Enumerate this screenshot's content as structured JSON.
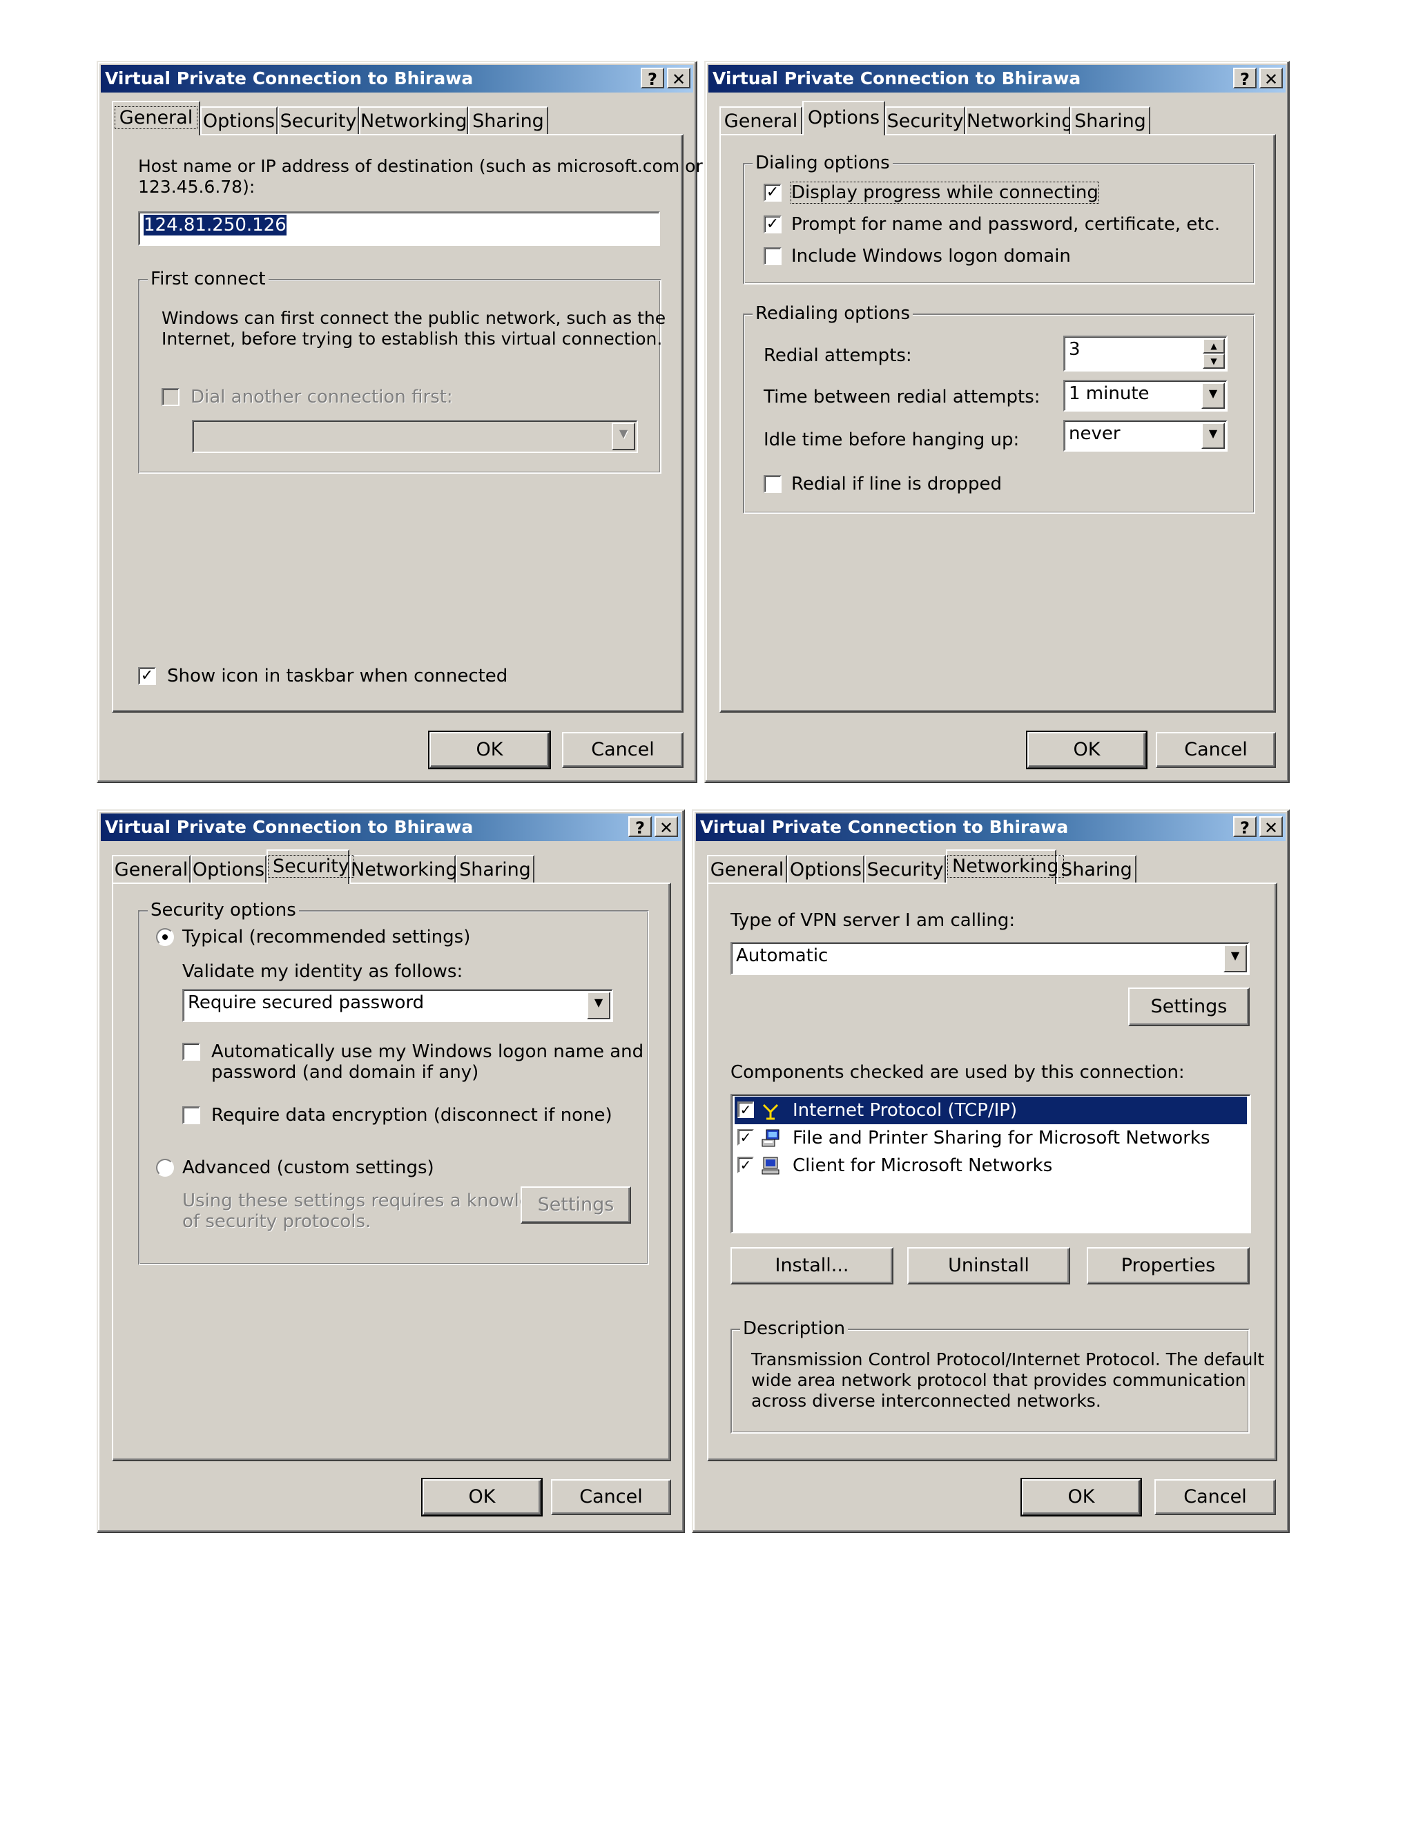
{
  "title": "Virtual Private Connection to Bhirawa",
  "title_buttons": {
    "help": "?",
    "close": "✕"
  },
  "tabs": [
    "General",
    "Options",
    "Security",
    "Networking",
    "Sharing"
  ],
  "buttons": {
    "ok": "OK",
    "cancel": "Cancel"
  },
  "general": {
    "host_label_1": "Host name or IP address of destination (such as microsoft.com or",
    "host_label_2": "123.45.6.78):",
    "host_value": "124.81.250.126",
    "first_connect_legend": "First connect",
    "first_connect_text_1": "Windows can first connect the public network, such as the",
    "first_connect_text_2": "Internet, before trying to establish this virtual connection.",
    "dial_another_label": "Dial another connection first:",
    "dial_another_checked": false,
    "show_icon_label": "Show icon in taskbar when connected",
    "show_icon_checked": true
  },
  "options": {
    "dialing_legend": "Dialing options",
    "display_progress_label": "Display progress while connecting",
    "display_progress_checked": true,
    "prompt_label": "Prompt for name and password, certificate, etc.",
    "prompt_checked": true,
    "include_domain_label": "Include Windows logon domain",
    "include_domain_checked": false,
    "redialing_legend": "Redialing options",
    "redial_attempts_label": "Redial attempts:",
    "redial_attempts_value": "3",
    "time_between_label": "Time between redial attempts:",
    "time_between_value": "1 minute",
    "idle_time_label": "Idle time before hanging up:",
    "idle_time_value": "never",
    "redial_dropped_label": "Redial if line is dropped",
    "redial_dropped_checked": false
  },
  "security": {
    "security_legend": "Security options",
    "typical_label": "Typical (recommended settings)",
    "typical_selected": true,
    "validate_label": "Validate my identity as follows:",
    "validate_value": "Require secured password",
    "auto_logon_label_1": "Automatically use my Windows logon name and",
    "auto_logon_label_2": "password (and domain if any)",
    "auto_logon_checked": false,
    "require_encryption_label": "Require data encryption (disconnect if none)",
    "require_encryption_checked": false,
    "advanced_label": "Advanced (custom settings)",
    "advanced_selected": false,
    "advanced_note_1": "Using these settings requires a knowledge",
    "advanced_note_2": "of security protocols.",
    "settings_button": "Settings"
  },
  "networking": {
    "vpn_type_label": "Type of VPN server I am calling:",
    "vpn_type_value": "Automatic",
    "settings_button": "Settings",
    "components_label": "Components checked are used by this connection:",
    "components": [
      {
        "label": "Internet Protocol (TCP/IP)",
        "checked": true,
        "icon": "network-protocol-icon",
        "selected": true
      },
      {
        "label": "File and Printer Sharing for Microsoft Networks",
        "checked": true,
        "icon": "file-printer-sharing-icon",
        "selected": false
      },
      {
        "label": "Client for Microsoft Networks",
        "checked": true,
        "icon": "network-client-icon",
        "selected": false
      }
    ],
    "install_button": "Install...",
    "uninstall_button": "Uninstall",
    "properties_button": "Properties",
    "description_legend": "Description",
    "description_1": "Transmission Control Protocol/Internet Protocol. The default",
    "description_2": "wide area network protocol that provides communication",
    "description_3": "across diverse interconnected networks."
  },
  "colors": {
    "dialog_face": "#d4d0c8",
    "title_gradient_start": "#0a246a",
    "title_gradient_end": "#a6caf0",
    "selection": "#0a246a"
  }
}
